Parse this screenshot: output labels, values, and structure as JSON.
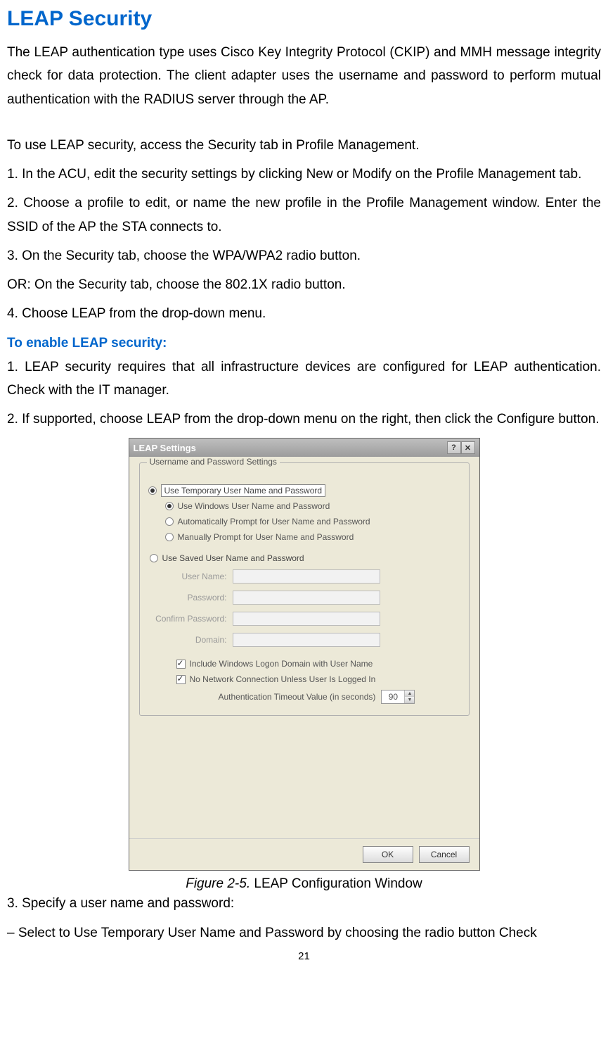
{
  "title": "LEAP Security",
  "intro": "The LEAP authentication type uses Cisco Key Integrity Protocol (CKIP) and MMH message integrity check for data protection. The client adapter uses the username and password to perform mutual authentication with the RADIUS server through the AP.",
  "use_intro": "To use LEAP security, access the Security tab in Profile Management.",
  "steps": {
    "s1": "1. In the ACU, edit the security settings by clicking New or Modify on the Profile Management tab.",
    "s2": "2. Choose a profile to edit, or name the new profile in the Profile Management window. Enter the SSID of the AP the STA connects to.",
    "s3": "3. On the Security tab, choose the WPA/WPA2 radio button.",
    "s3or": "OR: On the Security tab, choose the 802.1X radio button.",
    "s4": "4. Choose LEAP from the drop-down menu."
  },
  "enable_head": "To enable LEAP security:",
  "enable": {
    "e1": "1. LEAP security requires that all infrastructure devices are configured for LEAP authentication. Check with the IT manager.",
    "e2": "2. If supported, choose LEAP from the drop-down menu on the right, then click the Configure button."
  },
  "dialog": {
    "title": "LEAP Settings",
    "groupbox_title": "Username and Password Settings",
    "temp_header": "Use Temporary User Name and Password",
    "opt_win": "Use Windows User Name and Password",
    "opt_auto": "Automatically Prompt for User Name and Password",
    "opt_manual": "Manually Prompt for User Name and Password",
    "saved_header": "Use Saved User Name and Password",
    "lbl_user": "User Name:",
    "lbl_pass": "Password:",
    "lbl_conf": "Confirm Password:",
    "lbl_domain": "Domain:",
    "chk_include": "Include Windows Logon Domain with User Name",
    "chk_noconn": "No Network Connection Unless User Is Logged In",
    "timeout_label": "Authentication Timeout Value (in seconds)",
    "timeout_value": "90",
    "ok": "OK",
    "cancel": "Cancel",
    "help": "?",
    "close": "✕"
  },
  "caption_prefix": "Figure 2-5. ",
  "caption_text": "LEAP Configuration Window",
  "after": {
    "a3": "3. Specify a user name and password:",
    "a4": "– Select to Use Temporary User Name and Password by choosing the radio button Check"
  },
  "page_number": "21"
}
